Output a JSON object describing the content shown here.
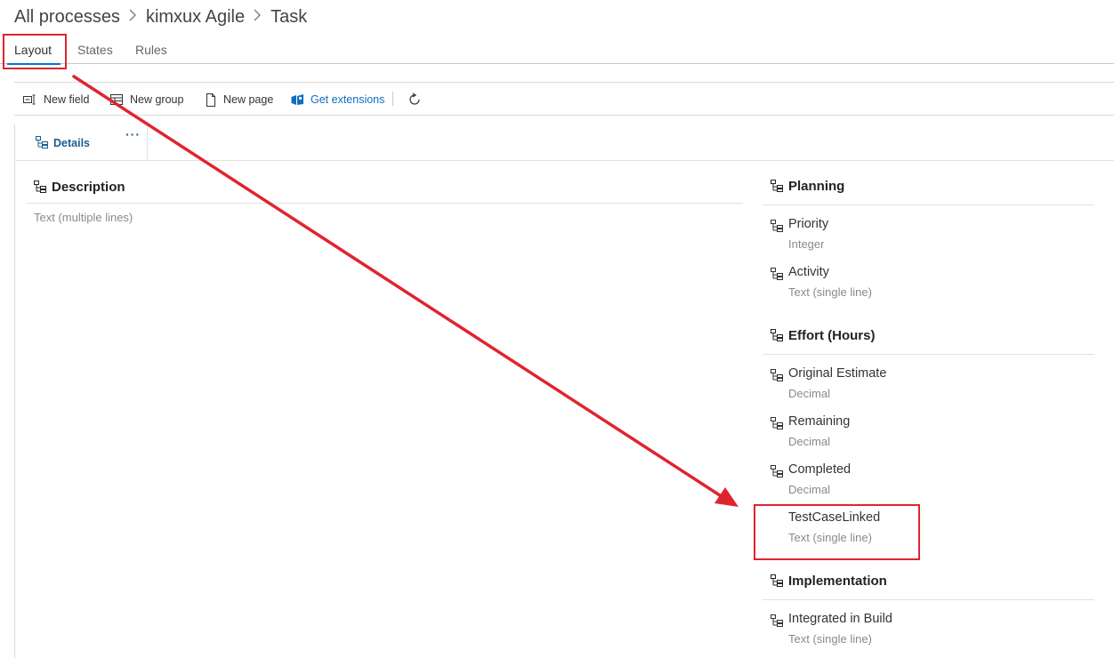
{
  "breadcrumb": {
    "items": [
      "All processes",
      "kimxux Agile",
      "Task"
    ]
  },
  "tabs": [
    "Layout",
    "States",
    "Rules"
  ],
  "toolbar": {
    "new_field": "New field",
    "new_group": "New group",
    "new_page": "New page",
    "get_extensions": "Get extensions"
  },
  "page_tab": {
    "label": "Details",
    "more": "···"
  },
  "left_column": {
    "group_title": "Description",
    "field_type": "Text (multiple lines)"
  },
  "right_column": {
    "groups": [
      {
        "title": "Planning",
        "fields": [
          {
            "name": "Priority",
            "type": "Integer"
          },
          {
            "name": "Activity",
            "type": "Text (single line)"
          }
        ]
      },
      {
        "title": "Effort (Hours)",
        "fields": [
          {
            "name": "Original Estimate",
            "type": "Decimal"
          },
          {
            "name": "Remaining",
            "type": "Decimal"
          },
          {
            "name": "Completed",
            "type": "Decimal"
          },
          {
            "name": "TestCaseLinked",
            "type": "Text (single line)"
          }
        ]
      },
      {
        "title": "Implementation",
        "fields": [
          {
            "name": "Integrated in Build",
            "type": "Text (single line)"
          }
        ]
      }
    ]
  },
  "colors": {
    "accent": "#0078d4",
    "link": "#106ebe",
    "annotation": "#e0242f"
  },
  "icons": [
    "chevron-right-icon",
    "new-field-icon",
    "new-group-icon",
    "new-page-icon",
    "extensions-icon",
    "refresh-icon",
    "drag-handle-icon",
    "more-icon"
  ]
}
